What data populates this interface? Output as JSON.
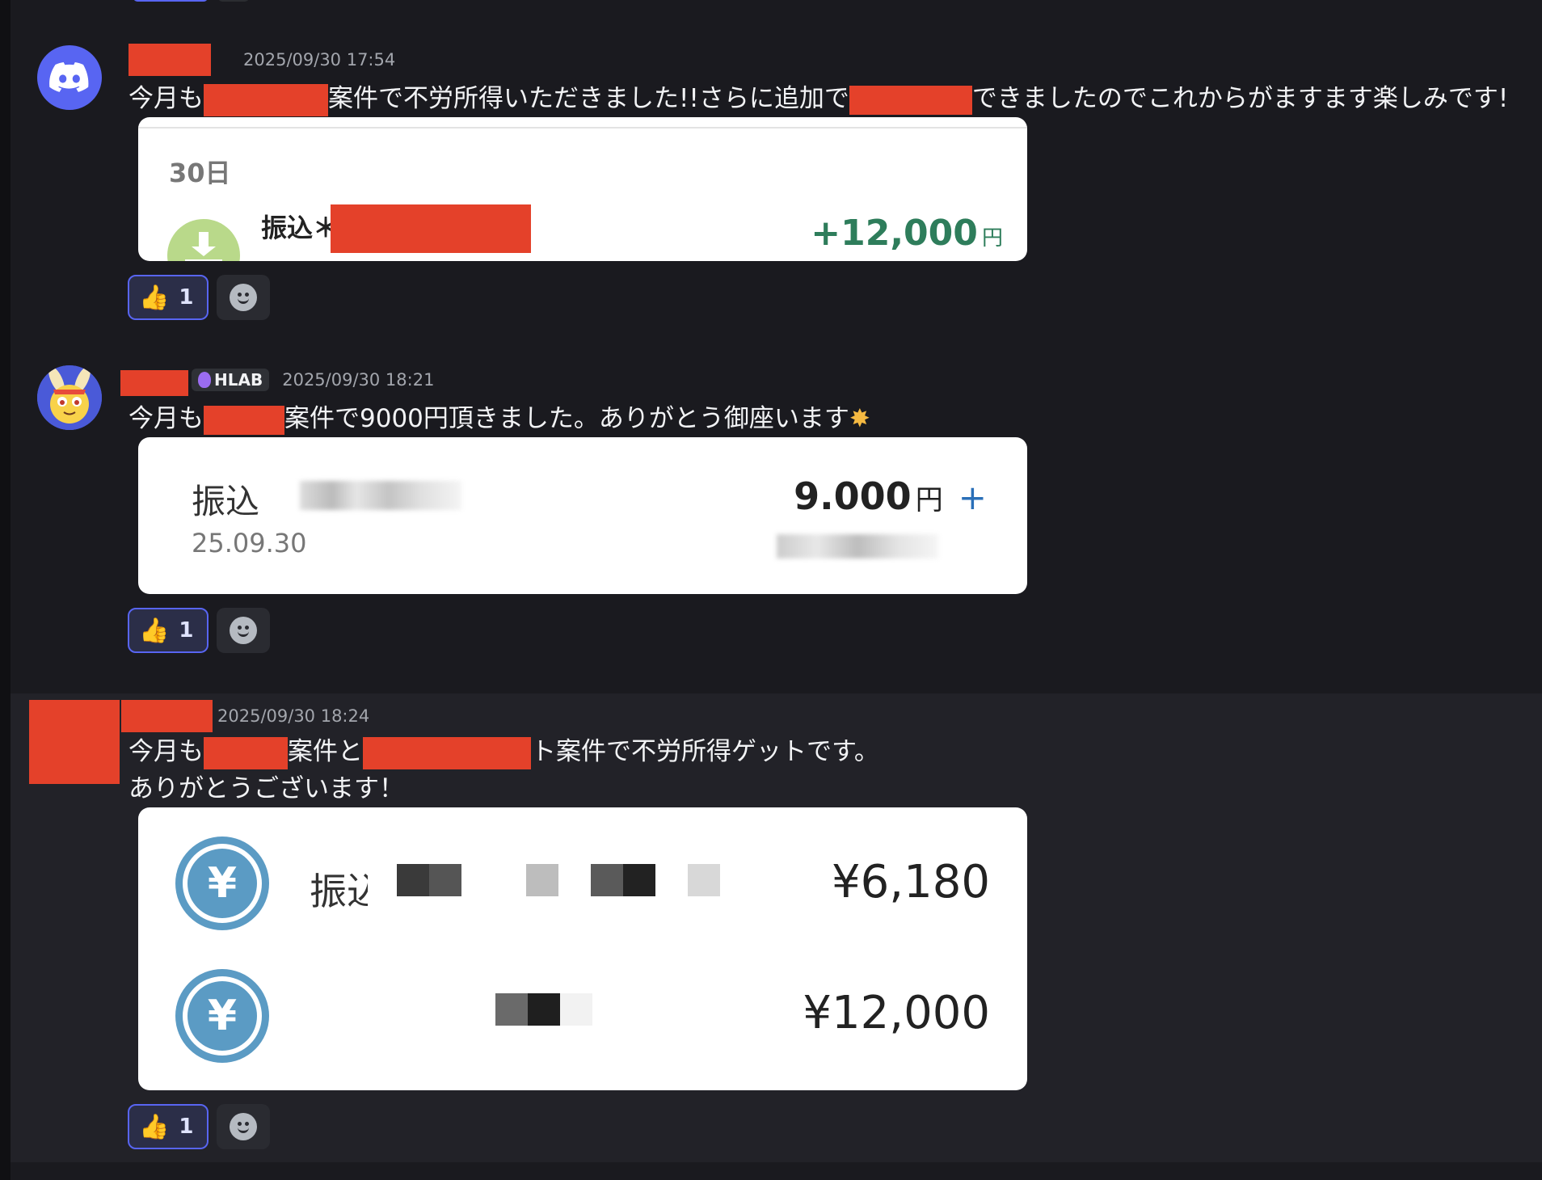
{
  "messages": [
    {
      "timestamp": "2025/09/30 17:54",
      "text_a": "今月も",
      "text_b": "案件で不労所得いただきました!!さらに追加で",
      "text_c": "できましたのでこれからがますます楽しみです!",
      "card": {
        "date": "30日",
        "label": "振込＊",
        "amount": "+12,000",
        "unit": "円"
      },
      "reaction_count": "1"
    },
    {
      "timestamp": "2025/09/30 18:21",
      "tag": "HLAB",
      "text_a": "今月も",
      "text_b": "案件で9000円頂きました。ありがとう御座います",
      "card": {
        "label": "振込",
        "date": "25.09.30",
        "amount": "9.000",
        "unit": "円",
        "plus": "+"
      },
      "reaction_count": "1"
    },
    {
      "timestamp": "2025/09/30 18:24",
      "text_a": "今月も",
      "text_b": "案件と",
      "text_c": "ト案件で不労所得ゲットです。",
      "line2": "ありがとうございます！",
      "card": {
        "row1_label": "振込",
        "row1_amount": "¥6,180",
        "row2_amount": "¥12,000",
        "yen_symbol": "¥"
      },
      "reaction_count": "1"
    }
  ],
  "colors": {
    "background": "#1a1a1f",
    "accent": "#5865f2",
    "redaction": "#e4412a",
    "positive": "#2e7d5b"
  }
}
